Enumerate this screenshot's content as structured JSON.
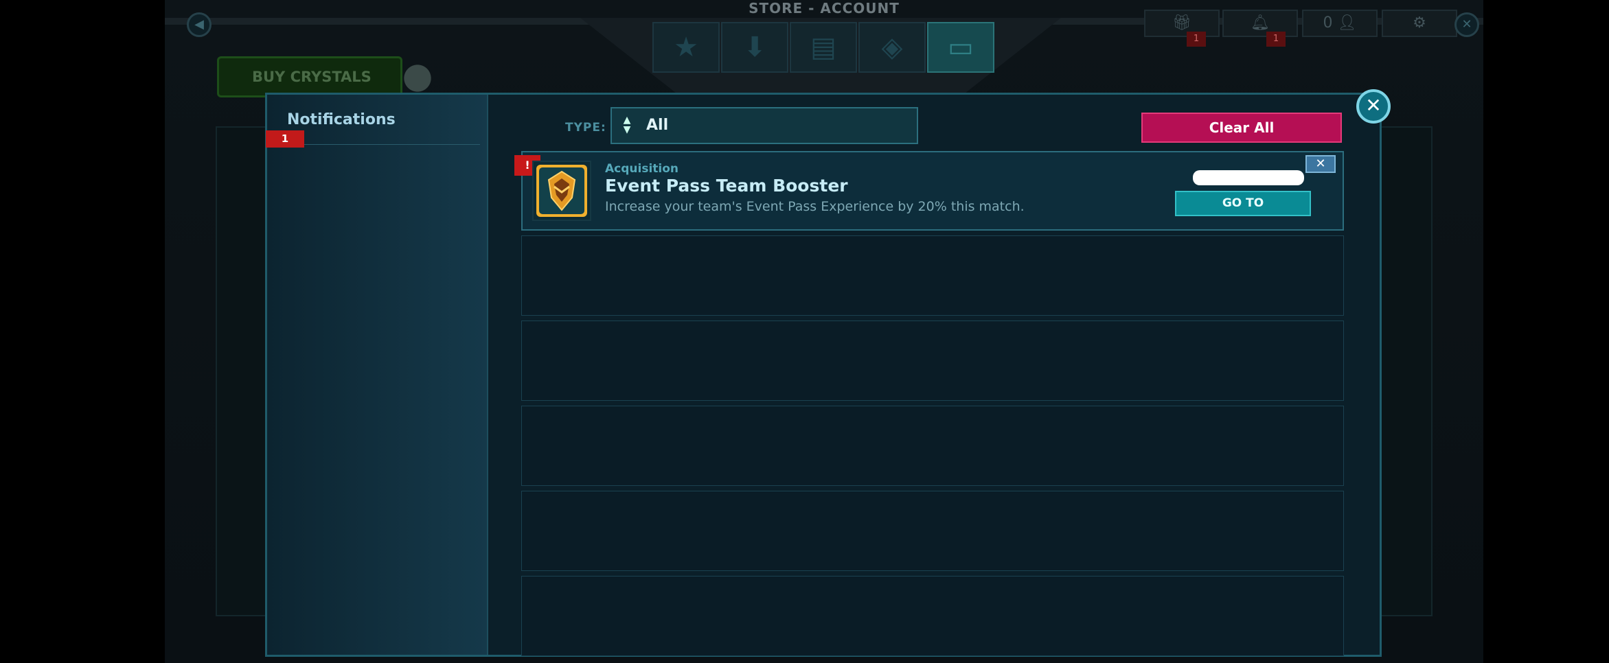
{
  "background": {
    "store_title": "STORE - ACCOUNT",
    "buy_crystals": "BUY CRYSTALS",
    "gift_badge": "1",
    "bell_badge": "1",
    "friends_count": "0"
  },
  "sidebar": {
    "title": "Notifications",
    "badge": "1"
  },
  "filter": {
    "type_label": "TYPE:",
    "type_value": "All"
  },
  "actions": {
    "clear_all": "Clear All"
  },
  "notifications": [
    {
      "is_new": true,
      "new_marker": "!",
      "type": "Acquisition",
      "title": "Event Pass Team Booster",
      "description": "Increase your team's Event Pass Experience by 20% this match.",
      "goto_label": "GO TO",
      "icon": "team-booster-emblem-icon"
    }
  ],
  "empty_slots": 5,
  "colors": {
    "accent": "#1f5c6b",
    "clear_all": "#b50f54",
    "goto": "#0a8b95",
    "badge": "#c21a1a"
  }
}
